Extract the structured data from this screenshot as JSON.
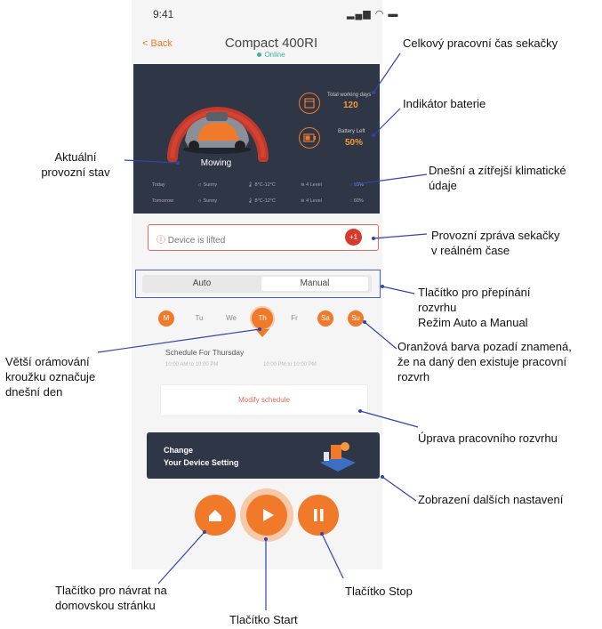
{
  "status_bar": {
    "time": "9:41",
    "icons": "signal wifi battery"
  },
  "header": {
    "back_label": "< Back",
    "title": "Compact 400RI",
    "online": "Online"
  },
  "status_panel": {
    "state": "Mowing",
    "stats": [
      {
        "label": "Total working days",
        "value": "120",
        "icon": "calendar-icon"
      },
      {
        "label": "Battery Left",
        "value": "50%",
        "icon": "battery-icon"
      }
    ],
    "weather": [
      {
        "day": "Today",
        "cond": "Sunny",
        "temp": "8°C-12°C",
        "wind": "4 Level",
        "humidity": "60%"
      },
      {
        "day": "Tomorrow",
        "cond": "Sunny",
        "temp": "8°C-12°C",
        "wind": "4 Level",
        "humidity": "60%"
      }
    ]
  },
  "message": {
    "text": "Device is lifted",
    "badge": "+1"
  },
  "mode": {
    "auto": "Auto",
    "manual": "Manual"
  },
  "days": [
    {
      "label": "M",
      "active": true,
      "today": false
    },
    {
      "label": "Tu",
      "active": false,
      "today": false
    },
    {
      "label": "We",
      "active": false,
      "today": false
    },
    {
      "label": "Th",
      "active": true,
      "today": true
    },
    {
      "label": "Fr",
      "active": false,
      "today": false
    },
    {
      "label": "Sa",
      "active": true,
      "today": false
    },
    {
      "label": "Su",
      "active": true,
      "today": false
    }
  ],
  "schedule": {
    "title": "Schedule For Thursday",
    "range1": "10:00 AM to 10:00 PM",
    "range2": "10:00 PM to 10:00 PM",
    "modify": "Modify schedule"
  },
  "banner": {
    "line1": "Change",
    "line2": "Your Device Setting"
  },
  "controls": {
    "home": "home-icon",
    "start": "play-icon",
    "stop": "pause-icon"
  },
  "callouts": {
    "total_time": "Celkový pracovní čas sekačky",
    "battery": "Indikátor baterie",
    "state_l1": "Aktuální",
    "state_l2": "provozní stav",
    "weather_l1": "Dnešní a zítřejší klimatické",
    "weather_l2": "údaje",
    "msg_l1": "Provozní zpráva sekačky",
    "msg_l2": "v reálném čase",
    "toggle_l1": "Tlačítko pro přepínání",
    "toggle_l2": "rozvrhu",
    "toggle_l3": "Režim Auto a Manual",
    "orange_l1": "Oranžová barva pozadí znamená,",
    "orange_l2": "že na daný den existuje pracovní",
    "orange_l3": "rozvrh",
    "today_l1": "Větší orámování",
    "today_l2": "kroužku označuje",
    "today_l3": "dnešní den",
    "edit": "Úprava pracovního rozvrhu",
    "more": "Zobrazení dalších nastavení",
    "home_l1": "Tlačítko pro návrat na",
    "home_l2": "domovskou stránku",
    "start": "Tlačítko Start",
    "stop": "Tlačítko Stop"
  },
  "colors": {
    "accent": "#f07a2a",
    "panel": "#2f3646",
    "alert": "#d63a2b",
    "callout_line": "#3344aa"
  }
}
